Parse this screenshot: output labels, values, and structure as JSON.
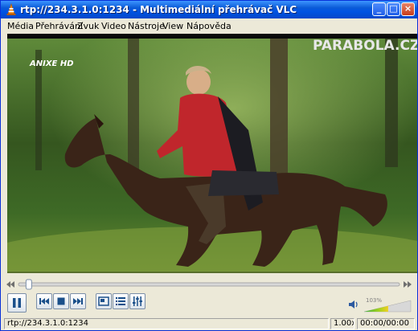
{
  "window": {
    "title": "rtp://234.3.1.0:1234 - Multimediální přehrávač VLC",
    "buttons": {
      "minimize": "_",
      "maximize": "□",
      "close": "×"
    }
  },
  "menu": [
    "Média",
    "Přehrávání",
    "Zvuk",
    "Video",
    "Nástroje",
    "View",
    "Nápověda"
  ],
  "video": {
    "channel_logo": "ANIXE HD",
    "watermark": "PARABOLA.CZ"
  },
  "seek": {
    "position": 0.02
  },
  "volume": {
    "label": "103%",
    "level": 1.03
  },
  "status": {
    "source": "rtp://234.3.1.0:1234",
    "speed": "1.00x",
    "time": "00:00/00:00"
  },
  "colors": {
    "titlebar": "#0054e3",
    "chrome": "#ece9d8",
    "volume_green": "#3bb03b",
    "volume_yellow": "#f0d020"
  }
}
